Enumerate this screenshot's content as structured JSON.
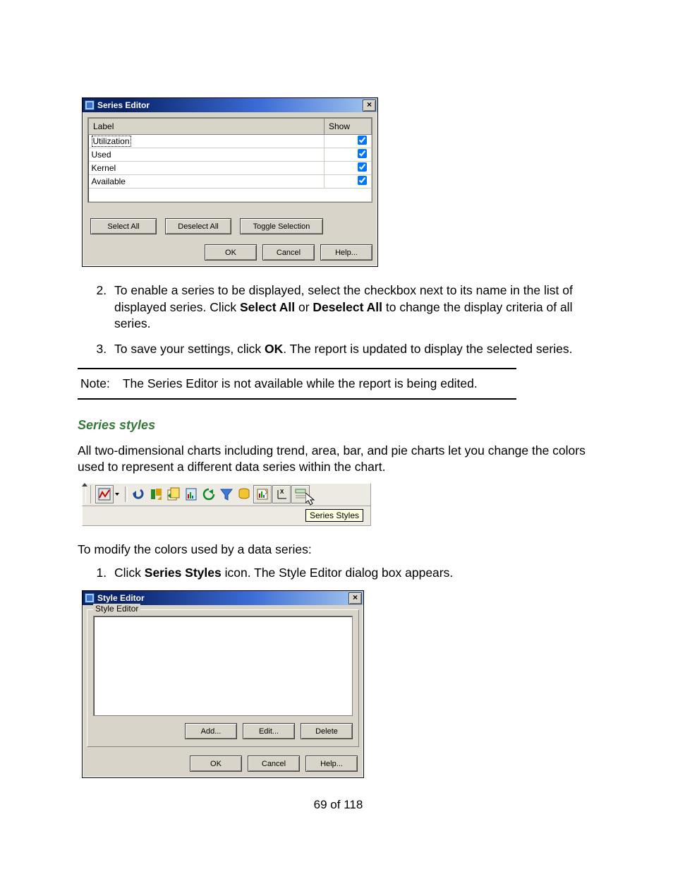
{
  "dialog1": {
    "title": "Series Editor",
    "columns": {
      "label": "Label",
      "show": "Show"
    },
    "rows": [
      {
        "label": "Utilization",
        "checked": true,
        "selected": true
      },
      {
        "label": "Used",
        "checked": true,
        "selected": false
      },
      {
        "label": "Kernel",
        "checked": true,
        "selected": false
      },
      {
        "label": "Available",
        "checked": true,
        "selected": false
      }
    ],
    "buttons": {
      "select_all": "Select All",
      "deselect_all": "Deselect All",
      "toggle": "Toggle Selection",
      "ok": "OK",
      "cancel": "Cancel",
      "help": "Help..."
    }
  },
  "step2": {
    "pre": "To enable a series to be displayed, select the checkbox next to its name in the list of displayed series. Click ",
    "b1": "Select All",
    "mid1": " or ",
    "b2": "Deselect All",
    "post": " to change the display criteria of all series."
  },
  "step3": {
    "pre": "To save your settings, click ",
    "b1": "OK",
    "post": ". The report is updated to display the selected series."
  },
  "note": {
    "label": "Note:",
    "text": "The Series Editor is not available while the report is being edited."
  },
  "section_header": "Series styles",
  "para1": "All two-dimensional charts including trend, area, bar, and pie charts let you change the colors used to represent a different data series within the chart.",
  "toolbar": {
    "tooltip": "Series Styles"
  },
  "para2": "To modify the colors used by a data series:",
  "stepA": {
    "pre": "Click ",
    "b1": "Series Styles",
    "post": " icon. The Style Editor dialog box appears."
  },
  "dialog2": {
    "title": "Style Editor",
    "group_label": "Style Editor",
    "buttons": {
      "add": "Add...",
      "edit": "Edit...",
      "delete": "Delete",
      "ok": "OK",
      "cancel": "Cancel",
      "help": "Help..."
    }
  },
  "page_number": "69 of 118"
}
